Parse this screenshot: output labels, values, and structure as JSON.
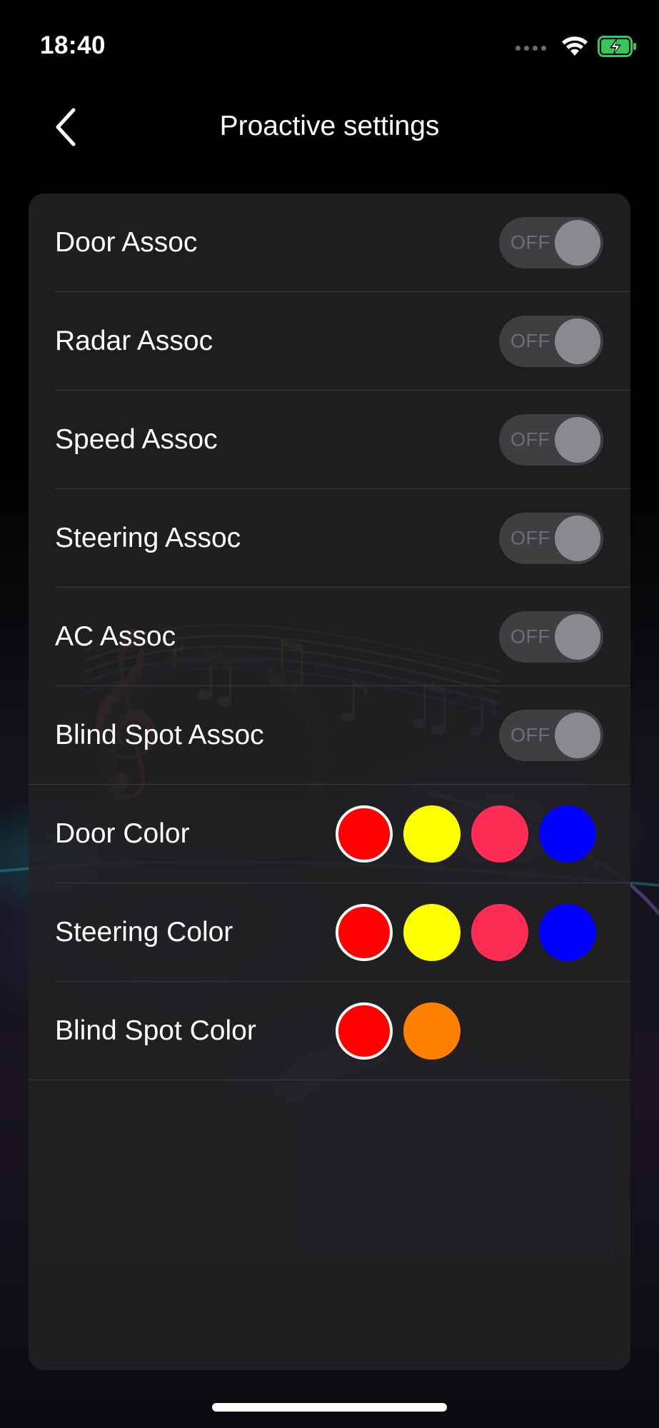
{
  "status_bar": {
    "time": "18:40",
    "icons": [
      "signal-dots-icon",
      "wifi-icon",
      "battery-charging-icon"
    ],
    "battery_color": "#34c759"
  },
  "nav": {
    "title": "Proactive settings",
    "back_icon": "chevron-left-icon"
  },
  "toggles": [
    {
      "label": "Door Assoc",
      "state": "OFF"
    },
    {
      "label": "Radar Assoc",
      "state": "OFF"
    },
    {
      "label": "Speed Assoc",
      "state": "OFF"
    },
    {
      "label": "Steering Assoc",
      "state": "OFF"
    },
    {
      "label": "AC Assoc",
      "state": "OFF"
    },
    {
      "label": "Blind Spot Assoc",
      "state": "OFF"
    }
  ],
  "color_rows": [
    {
      "label": "Door Color",
      "colors": [
        "#ff0000",
        "#ffff00",
        "#ff2d55",
        "#0000ff"
      ],
      "selected_index": 0
    },
    {
      "label": "Steering Color",
      "colors": [
        "#ff0000",
        "#ffff00",
        "#ff2d55",
        "#0000ff"
      ],
      "selected_index": 0
    },
    {
      "label": "Blind Spot Color",
      "colors": [
        "#ff0000",
        "#ff8000"
      ],
      "selected_index": 0
    }
  ],
  "theme": {
    "card_background": "#212123",
    "toggle_off_track": "#3f3f42",
    "toggle_off_knob": "#8a8a8e"
  }
}
